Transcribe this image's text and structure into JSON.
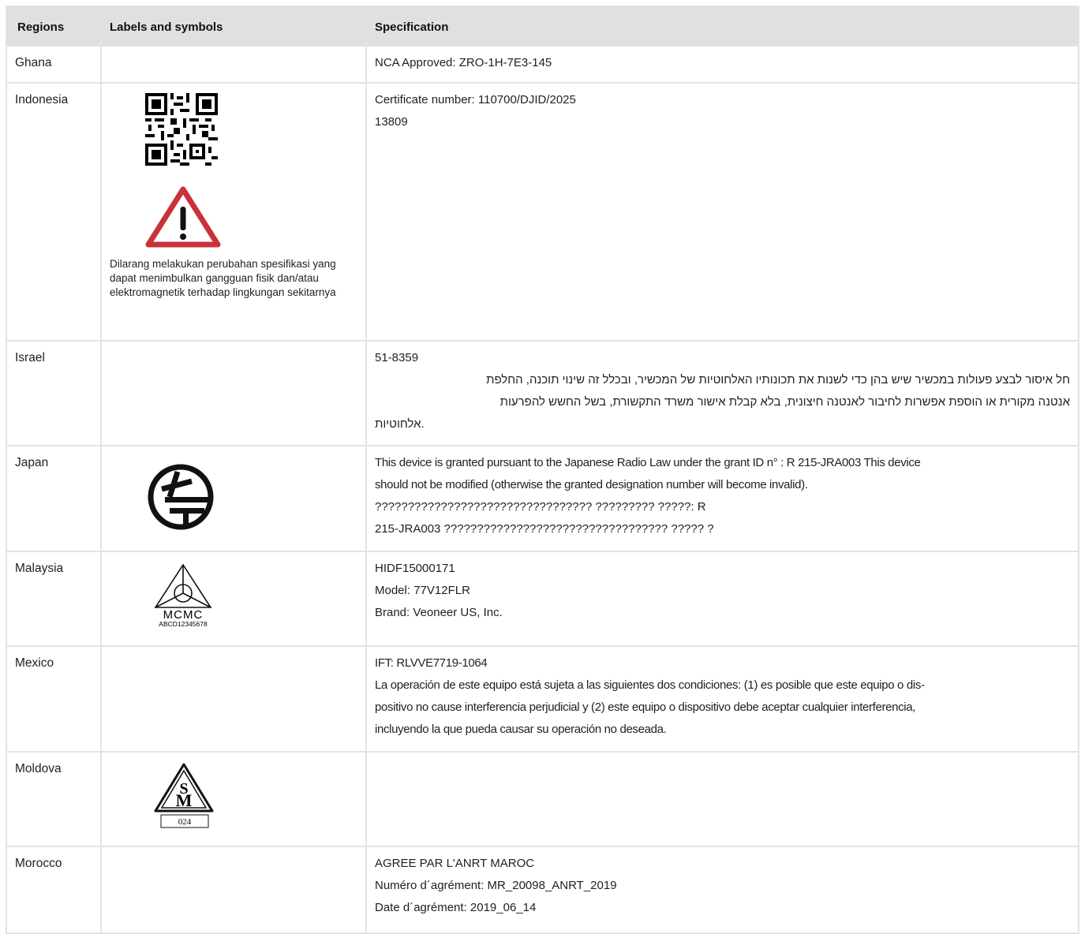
{
  "headers": {
    "regions": "Regions",
    "labels": "Labels and symbols",
    "spec": "Specification"
  },
  "rows": [
    {
      "region": "Ghana",
      "spec": [
        "NCA Approved: ZRO-1H-7E3-145"
      ]
    },
    {
      "region": "Indonesia",
      "label_text": "Dilarang melakukan perubahan spesifikasi yang dapat menimbulkan gangguan fisik dan/atau elektromagnetik terhadap lingkungan sekitarnya",
      "spec": [
        "Certificate number: 110700/DJID/2025",
        "13809"
      ]
    },
    {
      "region": "Israel",
      "spec": [
        "51-8359",
        "חל איסור לבצע פעולות במכשיר שיש בהן כדי לשנות את תכונותיו האלחוטיות של המכשיר, ובכלל זה שינוי תוכנה, החלפת",
        "אנטנה מקורית או הוספת אפשרות לחיבור לאנטנה חיצונית, בלא קבלת אישור משרד התקשורת, בשל החשש להפרעות",
        "אלחוטיות."
      ]
    },
    {
      "region": "Japan",
      "spec": [
        "This device is granted pursuant to the Japanese Radio Law under the grant ID n° : R 215-JRA003 This device",
        "should not be modified (otherwise the granted designation number will become invalid).",
        "????????????????????????????????? ????????? ?????: R",
        "215-JRA003 ?????????????????????????????????? ????? ?"
      ]
    },
    {
      "region": "Malaysia",
      "mcmc_text": "MCMC",
      "mcmc_id": "ABCD12345678",
      "spec": [
        "HIDF15000171",
        "Model: 77V12FLR",
        "Brand: Veoneer US, Inc."
      ]
    },
    {
      "region": "Mexico",
      "spec": [
        "IFT: RLVVE7719-1064",
        "La operación de este equipo está sujeta a las siguientes dos condiciones: (1) es posible que este equipo o dis-",
        "positivo no cause interferencia perjudicial y (2) este equipo o dispositivo debe aceptar cualquier interferencia,",
        "incluyendo la que pueda causar su operación no deseada."
      ]
    },
    {
      "region": "Moldova",
      "sm_number": "024",
      "spec": []
    },
    {
      "region": "Morocco",
      "spec": [
        "AGREE PAR L'ANRT MAROC",
        "Numéro d´agrément: MR_20098_ANRT_2019",
        "Date d´agrément: 2019_06_14"
      ]
    }
  ],
  "icons": {
    "indonesia_qr": "qr-code-icon",
    "indonesia_warning": "warning-triangle-icon",
    "japan": "japan-telec-mark-icon",
    "malaysia": "mcmc-mark-icon",
    "moldova": "moldova-sm-mark-icon"
  },
  "colors": {
    "header_bg": "#e0e0e0",
    "border": "#e3e3e3",
    "warning_red": "#c8323a"
  }
}
